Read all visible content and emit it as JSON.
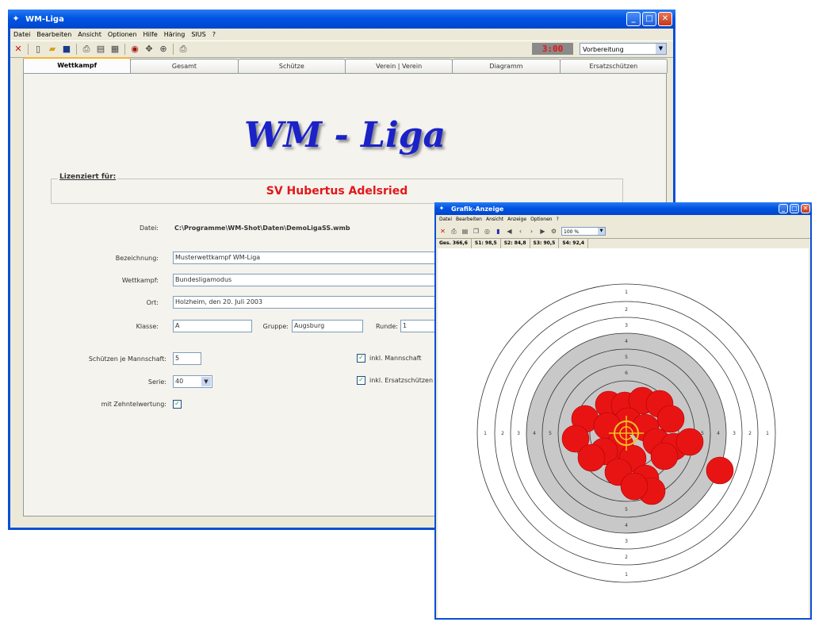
{
  "main_window": {
    "title": "WM-Liga",
    "menu": [
      "Datei",
      "Bearbeiten",
      "Ansicht",
      "Optionen",
      "Hilfe",
      "Häring",
      "SIUS",
      "?"
    ],
    "timer": "3:00",
    "phase": "Vorbereitung",
    "tabs": [
      "Wettkampf",
      "Gesamt",
      "Schütze",
      "Verein | Verein",
      "Diagramm",
      "Ersatzschützen"
    ],
    "active_tab": "Wettkampf",
    "logo": "WM - Liga",
    "license_label": "Lizenziert für:",
    "license_name": "SV Hubertus Adelsried",
    "form": {
      "file_label": "Datei:",
      "file_value": "C:\\Programme\\WM-Shot\\Daten\\DemoLigaSS.wmb",
      "designation_label": "Bezeichnung:",
      "designation_value": "Musterwettkampf WM-Liga",
      "competition_label": "Wettkampf:",
      "competition_value": "Bundesligamodus",
      "place_label": "Ort:",
      "place_value": "Holzheim, den 20. Juli 2003",
      "class_label": "Klasse:",
      "class_value": "A",
      "group_label": "Gruppe:",
      "group_value": "Augsburg",
      "round_label": "Runde:",
      "round_value": "1",
      "shooters_label": "Schützen je Mannschaft:",
      "shooters_value": "5",
      "series_label": "Serie:",
      "series_value": "40",
      "tenth_label": "mit Zehntelwertung:",
      "tenth_checked": true,
      "incl_team_label": "inkl. Mannschaft",
      "incl_team_checked": true,
      "incl_sub_label": "inkl. Ersatzschützen",
      "incl_sub_checked": true
    }
  },
  "graphic_window": {
    "title": "Grafik-Anzeige",
    "menu": [
      "Datei",
      "Bearbeiten",
      "Ansicht",
      "Anzeige",
      "Optionen",
      "?"
    ],
    "zoom": "100 %",
    "series_scores": [
      "Ges. 366,6",
      "S1: 98,5",
      "S2: 84,8",
      "S3: 90,5",
      "S4: 92,4"
    ],
    "ring_labels": [
      "1",
      "2",
      "3",
      "4",
      "5",
      "6"
    ],
    "colors": {
      "hit": "#e81414",
      "crosshair": "#f7c020",
      "target_gray": "#c8c8c8"
    }
  }
}
